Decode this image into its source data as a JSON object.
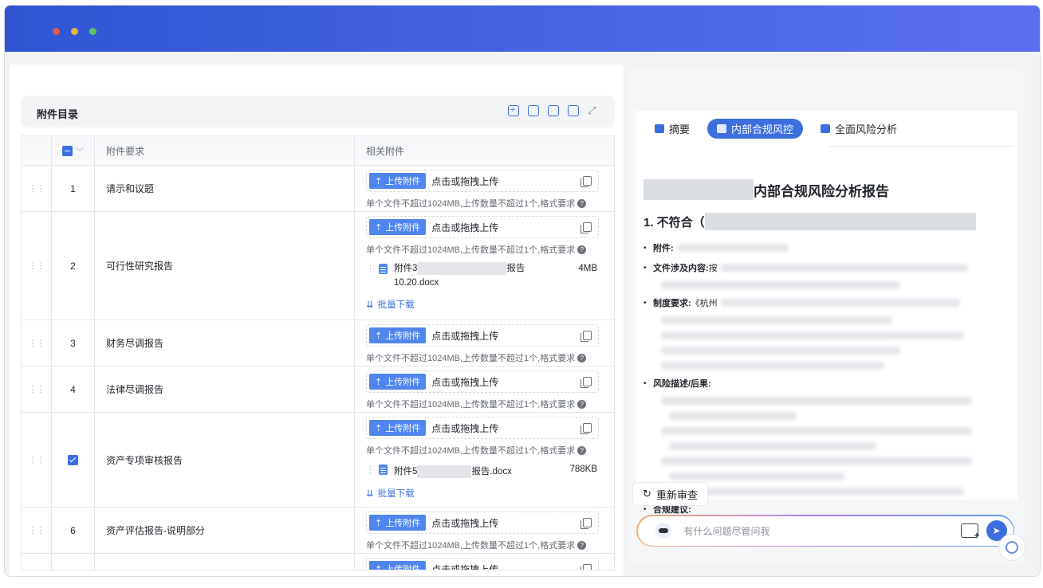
{
  "window": {
    "controls": [
      "close",
      "minimize",
      "maximize"
    ]
  },
  "attachments": {
    "title": "附件目录",
    "toolbar_icons": [
      "add-icon",
      "import-icon",
      "copy-icon",
      "edit-icon",
      "expand-icon"
    ],
    "columns": {
      "requirement": "附件要求",
      "related": "相关附件"
    },
    "upload_label": "上传附件",
    "drag_hint": "点击或拖拽上传",
    "limit_hint": "单个文件不超过1024MB,上传数量不超过1个,格式要求",
    "batch_download": "批量下载",
    "rows": [
      {
        "index": "1",
        "name": "请示和议题"
      },
      {
        "index": "2",
        "name": "可行性研究报告",
        "file": {
          "prefix": "附件3",
          "suffix": "报告",
          "line2": "10.20.docx",
          "size": "4MB"
        }
      },
      {
        "index": "3",
        "name": "财务尽调报告"
      },
      {
        "index": "4",
        "name": "法律尽调报告"
      },
      {
        "index": "",
        "name": "资产专项审核报告",
        "checked": true,
        "file": {
          "prefix": "附件5",
          "suffix": "报告.docx",
          "line2": "",
          "size": "788KB"
        }
      },
      {
        "index": "6",
        "name": "资产评估报告-说明部分"
      },
      {
        "index": "",
        "name": ""
      }
    ]
  },
  "review": {
    "tabs": [
      {
        "label": "摘要",
        "icon": "summary-icon"
      },
      {
        "label": "内部合规风控",
        "icon": "compliance-icon",
        "active": true
      },
      {
        "label": "全面风险分析",
        "icon": "folder-icon"
      }
    ],
    "report_title": "内部合规风险分析报告",
    "section1": "1. 不符合（",
    "items": {
      "attachment": "附件:",
      "file_content": "文件涉及内容:",
      "file_content_start": "按",
      "policy": "制度要求:",
      "policy_start": "《杭州",
      "risk": "风险描述/后果:",
      "compliance": "合规建议:"
    },
    "recheck_label": "重新审查",
    "chat_placeholder": "有什么问题尽管问我"
  },
  "colors": {
    "accent": "#3b6fe0",
    "titlebar": "#2f55d4"
  }
}
